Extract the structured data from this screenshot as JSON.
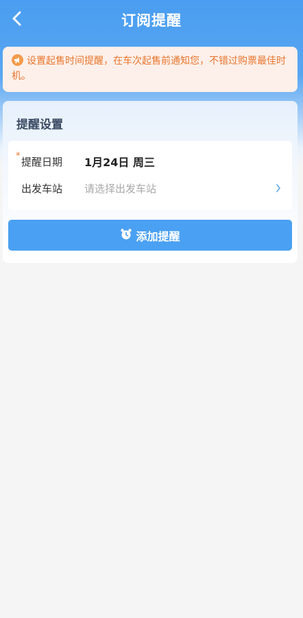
{
  "header": {
    "title": "订阅提醒",
    "back_icon": "chevron-left-icon"
  },
  "notice": {
    "icon": "megaphone-icon",
    "text": "设置起售时间提醒，在车次起售前通知您，不错过购票最佳时机。"
  },
  "settings": {
    "title": "提醒设置",
    "date": {
      "required_mark": "*",
      "label": "提醒日期",
      "value": "1月24日 周三"
    },
    "station": {
      "label": "出发车站",
      "placeholder": "请选择出发车站",
      "arrow_icon": "chevron-right-icon"
    },
    "add_button": {
      "icon": "alarm-clock-icon",
      "label": "添加提醒"
    }
  },
  "colors": {
    "primary_blue": "#4aa0f2",
    "notice_orange": "#e8762e",
    "notice_bg": "#fdf0ea"
  }
}
